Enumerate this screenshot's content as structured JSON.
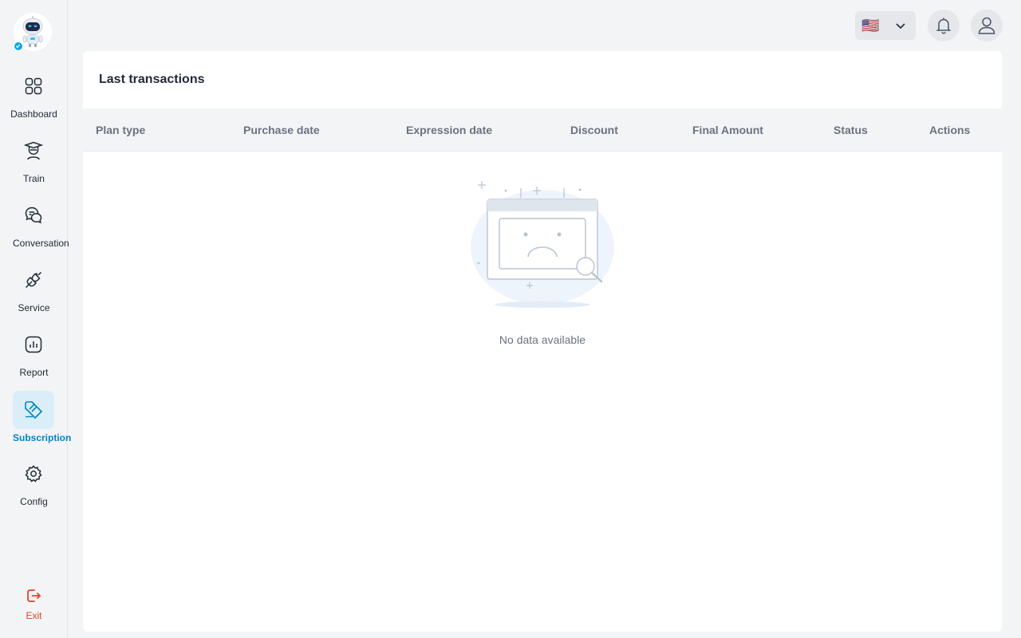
{
  "sidebar": {
    "items": [
      {
        "label": "Dashboard",
        "icon": "dashboard-icon"
      },
      {
        "label": "Train",
        "icon": "train-icon"
      },
      {
        "label": "Conversation",
        "icon": "conversation-icon"
      },
      {
        "label": "Service",
        "icon": "service-icon"
      },
      {
        "label": "Report",
        "icon": "report-icon"
      },
      {
        "label": "Subscription",
        "icon": "subscription-icon",
        "active": true
      },
      {
        "label": "Config",
        "icon": "gear-icon"
      }
    ],
    "exit_label": "Exit"
  },
  "topbar": {
    "language_flag": "🇺🇸"
  },
  "main": {
    "title": "Last transactions",
    "columns": [
      "Plan type",
      "Purchase date",
      "Expression date",
      "Discount",
      "Final Amount",
      "Status",
      "Actions"
    ],
    "empty_text": "No data available"
  },
  "colors": {
    "accent": "#0284c7",
    "accent_bg": "#d9eef8",
    "exit": "#e2461f"
  }
}
